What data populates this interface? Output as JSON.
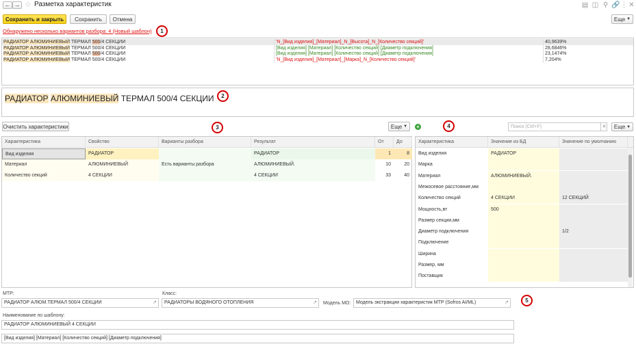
{
  "window": {
    "title": "Разметка характеристик"
  },
  "toolbar": {
    "save_close": "Сохранить и закрыть",
    "save": "Сохранить",
    "cancel": "Отмена",
    "more": "Еще"
  },
  "markers": [
    "1",
    "2",
    "3",
    "4",
    "5"
  ],
  "variants_link": "Обнаружено несколько вариантов разбора: 4 (Новый шаблон)",
  "variants": [
    {
      "parts": [
        "РАДИАТОР ",
        "АЛЮМИНИЕВЫЙ",
        " ТЕРМАЛ ",
        "500",
        "/4 СЕКЦИИ"
      ],
      "pattern": "'N_[Вид изделия]_[Материал]_N_[Высота]_N_[Количество секций]'",
      "pct": "40,9639%"
    },
    {
      "parts": [
        "РАДИАТОР ",
        "АЛЮМИНИЕВЫЙ",
        " ТЕРМАЛ ",
        "500",
        "/4 СЕКЦИИ"
      ],
      "pattern": "[Вид изделия] [Материал] [Количество секций] [Диаметр подключения]",
      "pct": "28,6846%"
    },
    {
      "parts": [
        "РАДИАТОР ",
        "АЛЮМИНИЕВЫЙ",
        " ТЕРМАЛ ",
        "500",
        "/4 СЕКЦИИ"
      ],
      "pattern": "[Вид изделия] [Материал] [Количество секций] [Диаметр подключения]",
      "pct": "23,1474%"
    },
    {
      "parts": [
        "РАДИАТОР ",
        "АЛЮМИНИЕВЫЙ",
        " ТЕРМАЛ ",
        "500",
        "/4 СЕКЦИИ"
      ],
      "pattern": "'N_[Вид изделия]_[Материал]_[Марка]_N_[Количество секций]'",
      "pct": "7,204%"
    }
  ],
  "big_text": {
    "w1": "РАДИАТОР",
    "w2": "АЛЮМИНИЕВЫЙ",
    "rest": "ТЕРМАЛ 500/4 СЕКЦИИ"
  },
  "left_panel": {
    "clear_btn": "Очистить характеристики",
    "more": "Еще",
    "headers": [
      "Характеристика",
      "Свойство",
      "Варианты разбора",
      "Результат",
      "От",
      "До"
    ],
    "rows": [
      [
        "Вид изделия",
        "РАДИАТОР",
        "",
        "РАДИАТОР",
        "1",
        "8"
      ],
      [
        "Материал",
        "АЛЮМИНИЕВЫЙ",
        "Есть варианты разбора",
        "АЛЮМИНИЕВЫЙ.",
        "10",
        "20"
      ],
      [
        "Количество секций",
        "4 СЕКЦИИ",
        "",
        "4 СЕКЦИИ",
        "33",
        "40"
      ]
    ]
  },
  "right_panel": {
    "search_placeholder": "Поиск (Ctrl+F)",
    "more": "Еще",
    "headers": [
      "Характеристика",
      "Значение из БД",
      "Значение по умолчанию"
    ],
    "rows": [
      [
        "Вид изделия",
        "РАДИАТОР",
        ""
      ],
      [
        "Марка",
        "",
        ""
      ],
      [
        "Материал",
        "АЛЮМИНИЕВЫЙ.",
        ""
      ],
      [
        "Межосевое расстояние,мм",
        "",
        ""
      ],
      [
        "Количество секций",
        "4 СЕКЦИИ",
        "12 СЕКЦИЙ"
      ],
      [
        "Мощность,вт",
        "500",
        ""
      ],
      [
        "Размер секции,мм",
        "",
        ""
      ],
      [
        "Диаметр подключения",
        "",
        "1/2"
      ],
      [
        "Подключение",
        "",
        ""
      ],
      [
        "Ширина",
        "",
        ""
      ],
      [
        "Размер, мм",
        "",
        ""
      ],
      [
        "Поставщик",
        "",
        ""
      ]
    ]
  },
  "bottom": {
    "mtr_label": "МТР:",
    "mtr_value": "РАДИАТОР АЛЮМ.ТЕРМАЛ 500/4 СЕКЦИИ",
    "class_label": "Класс:",
    "class_value": "РАДИАТОРЫ ВОДЯНОГО ОТОПЛЕНИЯ",
    "model_label": "Модель МО:",
    "model_value": "Модель экстракции характеристик МТР (Sofros AI/ML)",
    "template_label": "Наименование по шаблону:",
    "template_value": "РАДИАТОР АЛЮМИНИЕВЫЙ 4 СЕКЦИИ",
    "pattern_value": "[Вид изделия] [Материал] [Количество секций] [Диаметр подключения]"
  },
  "colors": {
    "accent_yellow": "#f5cf15",
    "marker_red": "#d40000",
    "highlight_orange": "#fbe6bd",
    "highlight_salmon": "#f5c4a8",
    "cell_yellow": "#fffcde"
  }
}
